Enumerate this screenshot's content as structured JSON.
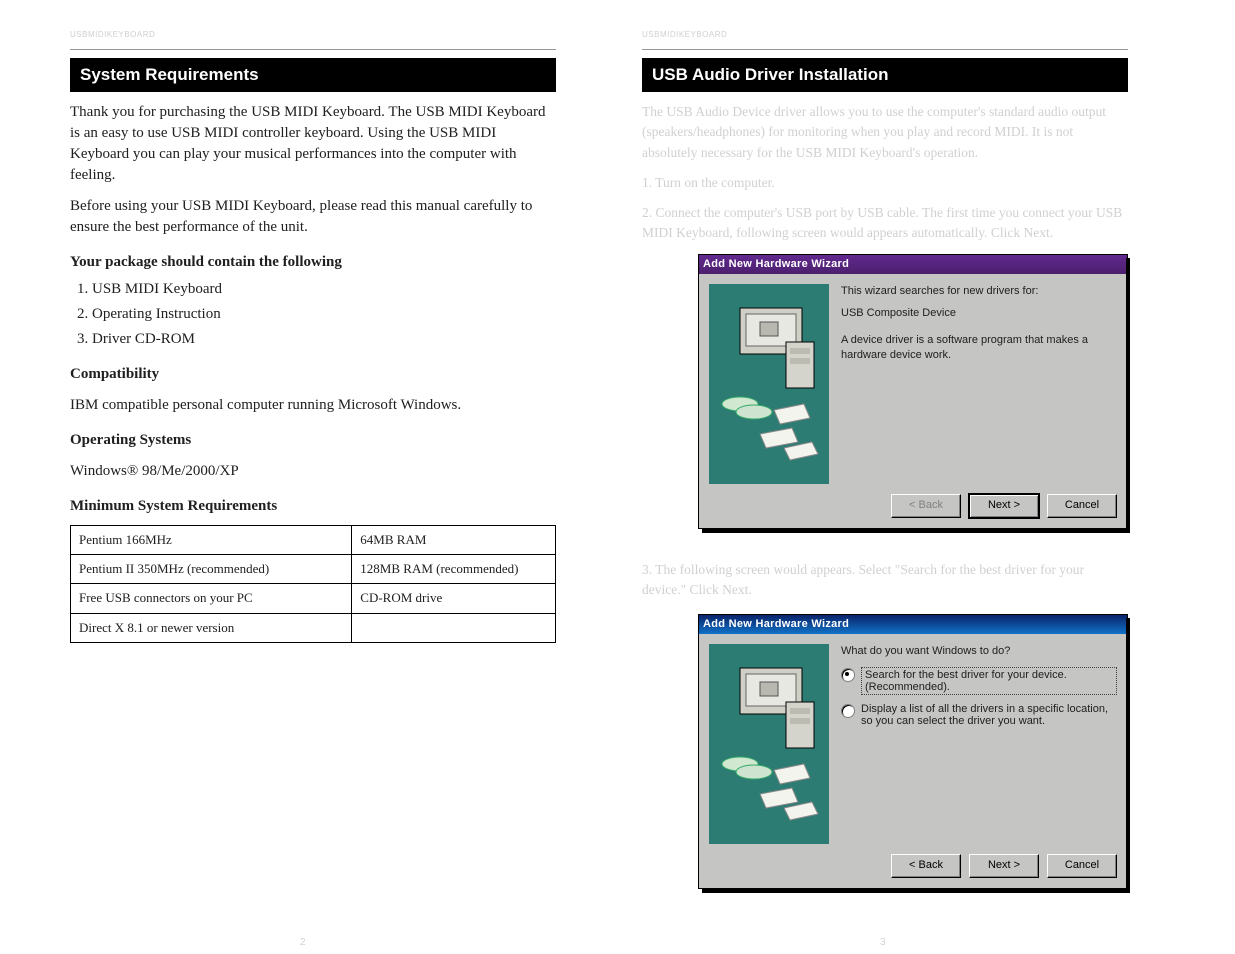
{
  "left": {
    "caption": "USBMIDIKEYBOARD",
    "title": "System Requirements",
    "p1": "Thank you for purchasing the USB MIDI Keyboard. The USB MIDI Keyboard is an easy to use USB MIDI controller keyboard. Using the USB MIDI Keyboard you can play your musical performances into the computer with feeling.",
    "p2": "Before using your USB MIDI Keyboard, please read this manual carefully to ensure the best performance of the unit.",
    "h2_1": "Your package should contain the following",
    "bul1_1": "USB MIDI Keyboard",
    "bul1_2": "Operating Instruction",
    "bul1_3": "Driver CD-ROM",
    "h2_2": "Compatibility",
    "p3": "IBM compatible personal computer running Microsoft Windows.",
    "h2_3": "Operating Systems",
    "p4": "Windows® 98/Me/2000/XP",
    "h2_4": "Minimum System Requirements",
    "table": {
      "rows": [
        [
          "Pentium 166MHz",
          "64MB RAM"
        ],
        [
          "Pentium II 350MHz (recommended)",
          "128MB RAM (recommended)"
        ],
        [
          "Free USB connectors on your PC",
          "CD-ROM drive"
        ],
        [
          "Direct X 8.1 or newer version",
          ""
        ]
      ]
    },
    "pagenum": "2"
  },
  "right": {
    "caption": "USBMIDIKEYBOARD",
    "title": "USB Audio Driver Installation",
    "intro1": "The USB Audio Device driver allows you to use the computer's standard audio output (speakers/headphones) for monitoring when you play and record MIDI. It is not absolutely necessary for the USB MIDI Keyboard's operation.",
    "step1": "1. Turn on the computer.",
    "step2": "2. Connect the computer's USB port by USB cable. The first time you connect your USB MIDI Keyboard, following screen would appears automatically. Click Next.",
    "wiz1": {
      "title": "Add New Hardware Wizard",
      "line1": "This wizard searches for new drivers for:",
      "line2": "USB Composite Device",
      "line3": "A device driver is a software program that makes a hardware device work.",
      "back": "< Back",
      "next": "Next >",
      "cancel": "Cancel"
    },
    "step3": "3. The following screen would appears. Select \"Search for the best driver for your device.\" Click Next.",
    "wiz2": {
      "title": "Add New Hardware Wizard",
      "q": "What do you want Windows to do?",
      "opt1": "Search for the best driver for your device. (Recommended).",
      "opt2": "Display a list of all the drivers in a specific location, so you can select the driver you want.",
      "back": "< Back",
      "next": "Next >",
      "cancel": "Cancel"
    },
    "pagenum": "3"
  }
}
